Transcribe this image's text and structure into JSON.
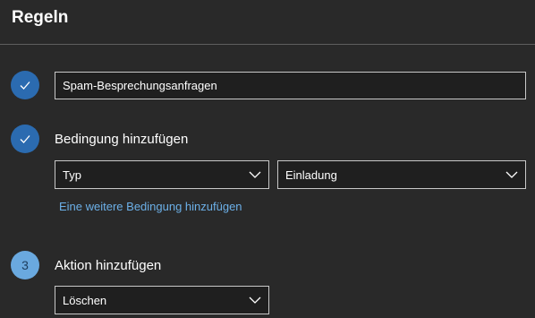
{
  "header": {
    "title": "Regeln"
  },
  "rule": {
    "name_value": "Spam-Besprechungsanfragen"
  },
  "steps": {
    "step1_icon": "checkmark-icon",
    "step2_icon": "checkmark-icon",
    "step3_number": "3"
  },
  "condition": {
    "label": "Bedingung hinzufügen",
    "type_selected": "Typ",
    "value_selected": "Einladung",
    "add_more_link": "Eine weitere Bedingung hinzufügen"
  },
  "action": {
    "label": "Aktion hinzufügen",
    "selected": "Löschen"
  },
  "colors": {
    "background": "#292929",
    "accent_done": "#2b6bb0",
    "accent_active": "#6aa9df",
    "link": "#6cb0e8",
    "field_border": "#c8c8c8"
  }
}
